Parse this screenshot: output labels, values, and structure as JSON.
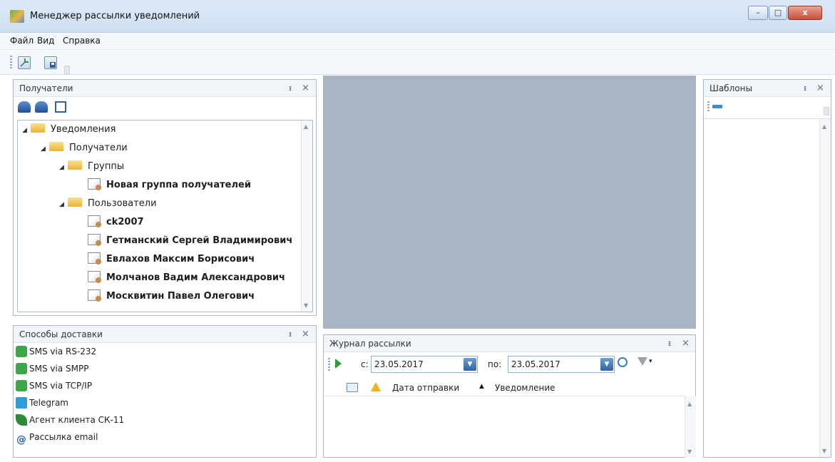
{
  "window": {
    "title": "Менеджер рассылки уведомлений",
    "minimize": "–",
    "maximize": "□",
    "close": "x"
  },
  "menu": [
    "Файл",
    "Вид",
    "Справка"
  ],
  "toolbar": {
    "icons": [
      "new-notification-icon",
      "save-notification-icon"
    ]
  },
  "recipients_panel": {
    "title": "Получатели",
    "pin": "ᵻ",
    "close": "×",
    "tools": [
      "filter-recipients-icon",
      "find-recipients-icon",
      "copy-icon"
    ],
    "tree": {
      "root": "Уведомления",
      "recipients": "Получатели",
      "groups": "Группы",
      "group_items": [
        "Новая группа получателей"
      ],
      "users": "Пользователи",
      "user_items": [
        "ck2007",
        "Гетманский Сергей Владимирович",
        "Евлахов Максим Борисович",
        "Молчанов Вадим Александрович",
        "Москвитин Павел Олегович"
      ]
    }
  },
  "delivery_panel": {
    "title": "Способы доставки",
    "pin": "ᵻ",
    "close": "×",
    "items": [
      {
        "label": "SMS via RS-232",
        "icon": "sms-icon"
      },
      {
        "label": "SMS via SMPP",
        "icon": "sms-icon"
      },
      {
        "label": "SMS via TCP/IP",
        "icon": "sms-icon"
      },
      {
        "label": "Telegram",
        "icon": "telegram-icon"
      },
      {
        "label": "Агент клиента СК-11",
        "icon": "leaf-icon"
      },
      {
        "label": "Рассылка email",
        "icon": "email-at-icon"
      }
    ]
  },
  "journal_panel": {
    "title": "Журнал рассылки",
    "pin": "ᵻ",
    "close": "×",
    "from_label": "с:",
    "from_date": "23.05.2017",
    "to_label": "по:",
    "to_date": "23.05.2017",
    "columns": [
      "Дата отправки",
      "Уведомление"
    ],
    "filter_caret": "▾"
  },
  "templates_panel": {
    "title": "Шаблоны",
    "pin": "ᵻ",
    "close": "×"
  },
  "colors": {
    "accent": "#2f62a8",
    "folder": "#e9b43a",
    "mdi": "#a9b5c3",
    "sms": "#3ea64a",
    "telegram": "#2f9ed8"
  }
}
